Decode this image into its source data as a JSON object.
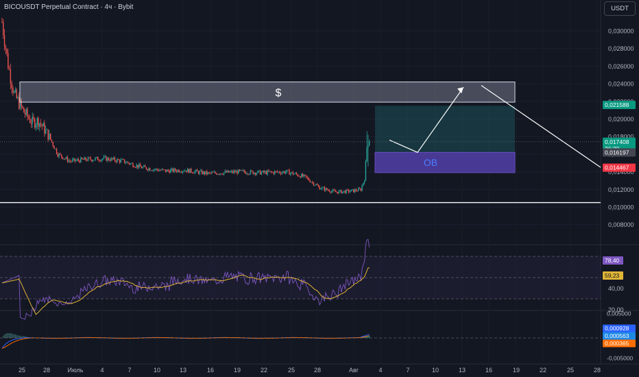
{
  "header": {
    "title": "BICOUSDT Perpetual Contract · 4ч · Bybit",
    "currency_button": "USDT"
  },
  "colors": {
    "background": "#131722",
    "up": "#26a69a",
    "down": "#ef5350",
    "rsi": "#7e57c2",
    "rsi_ma": "#e0b436",
    "liquidity_box": "#b7bcd0",
    "ob_box": "#5a3bb0",
    "target_box": "#1f6f78",
    "macd_line": "#2962ff",
    "signal_line": "#ff6d00"
  },
  "price_axis": {
    "labels": [
      "0,030000",
      "0,028000",
      "0,026000",
      "0,024000",
      "0,022000",
      "0,020000",
      "0,018000",
      "0,016000",
      "0,014000",
      "0,012000",
      "0,010000",
      "0,008000"
    ],
    "badges": [
      {
        "value": 0.021588,
        "text": "0,021588",
        "color": "#089981"
      },
      {
        "value": 0.017408,
        "text": "0,017408",
        "sub": "36:30",
        "color": "#089981"
      },
      {
        "value": 0.016197,
        "text": "0,016197",
        "color": "#434651"
      },
      {
        "value": 0.014467,
        "text": "0,014467",
        "color": "#f23645"
      }
    ]
  },
  "annotations": {
    "liquidity_label": "$",
    "ob_label": "OB"
  },
  "rsi_axis": {
    "labels": [
      "40,00",
      "20,00"
    ],
    "badges": [
      {
        "text": "78,40",
        "color": "#7e57c2"
      },
      {
        "text": "59,23",
        "color": "#e0b436",
        "textColor": "#131722"
      }
    ]
  },
  "macd_axis": {
    "labels": [
      "0,005000",
      "-0,005000"
    ],
    "badges": [
      {
        "text": "0,000928",
        "color": "#2962ff"
      },
      {
        "text": "0,000563",
        "color": "#1e88e5"
      },
      {
        "text": "0,000365",
        "color": "#ff6d00"
      }
    ]
  },
  "time_axis": [
    "25",
    "28",
    "Июль",
    "4",
    "7",
    "10",
    "13",
    "16",
    "19",
    "22",
    "25",
    "28",
    "Авг",
    "4",
    "7",
    "10",
    "13",
    "16",
    "19",
    "22",
    "25",
    "28"
  ],
  "chart_data": {
    "type": "candlestick",
    "symbol": "BICOUSDT",
    "timeframe": "4ч",
    "price_range": [
      0.0068,
      0.032
    ],
    "levels": {
      "liquidity_zone": [
        0.0219,
        0.0242
      ],
      "order_block": [
        0.0139,
        0.0162
      ],
      "target_zone": [
        0.0139,
        0.0215
      ],
      "support_line": 0.0105
    },
    "projection_path": [
      0.0176,
      0.0162,
      0.0236
    ],
    "projection_line": [
      0.0238,
      0.0145
    ],
    "key_prices": {
      "last": 0.017408,
      "target": 0.021588,
      "ob_mid": 0.016197,
      "stop": 0.014467
    },
    "anchors": [
      [
        0,
        0.031
      ],
      [
        5,
        0.0262
      ],
      [
        10,
        0.0228
      ],
      [
        18,
        0.0208
      ],
      [
        25,
        0.0196
      ],
      [
        30,
        0.0198
      ],
      [
        38,
        0.0182
      ],
      [
        46,
        0.016
      ],
      [
        56,
        0.0152
      ],
      [
        70,
        0.0154
      ],
      [
        85,
        0.0155
      ],
      [
        100,
        0.0152
      ],
      [
        115,
        0.0145
      ],
      [
        135,
        0.0141
      ],
      [
        150,
        0.0142
      ],
      [
        170,
        0.0138
      ],
      [
        195,
        0.014
      ],
      [
        215,
        0.0139
      ],
      [
        235,
        0.014
      ],
      [
        250,
        0.0134
      ],
      [
        262,
        0.0122
      ],
      [
        275,
        0.0117
      ],
      [
        288,
        0.0118
      ],
      [
        296,
        0.012
      ],
      [
        299,
        0.0132
      ],
      [
        301,
        0.0168
      ],
      [
        303,
        0.0176
      ]
    ],
    "rsi": {
      "last": 78.4,
      "ma": 59.23
    },
    "macd": {
      "macd": 0.000928,
      "hist": 0.000563,
      "signal": 0.000365
    }
  }
}
